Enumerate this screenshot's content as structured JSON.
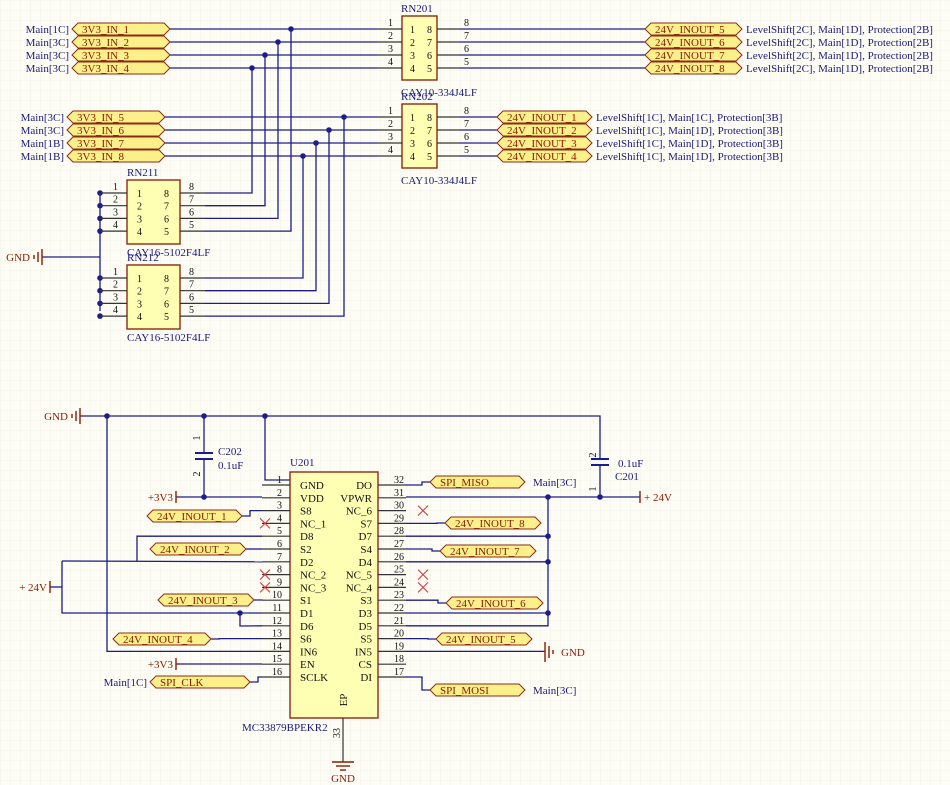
{
  "colors": {
    "wire": "#1c1c8c",
    "component_fill": "#ffffb4",
    "port_fill": "#fbf08a",
    "power": "#8b1a00",
    "background": "#fdfcf5"
  },
  "rn_top": [
    {
      "ref": "RN201",
      "value": "CAY10-334J4LF",
      "left_ports": [
        {
          "net": "3V3_IN_1",
          "sheet_ref": "Main[1C]"
        },
        {
          "net": "3V3_IN_2",
          "sheet_ref": "Main[3C]"
        },
        {
          "net": "3V3_IN_3",
          "sheet_ref": "Main[3C]"
        },
        {
          "net": "3V3_IN_4",
          "sheet_ref": "Main[3C]"
        }
      ],
      "right_ports": [
        {
          "net": "24V_INOUT_5",
          "sheet_ref": "LevelShift[2C], Main[1D], Protection[2B]"
        },
        {
          "net": "24V_INOUT_6",
          "sheet_ref": "LevelShift[2C], Main[1D], Protection[2B]"
        },
        {
          "net": "24V_INOUT_7",
          "sheet_ref": "LevelShift[2C], Main[1D], Protection[2B]"
        },
        {
          "net": "24V_INOUT_8",
          "sheet_ref": "LevelShift[2C], Main[1D], Protection[2B]"
        }
      ]
    },
    {
      "ref": "RN202",
      "value": "CAY10-334J4LF",
      "left_ports": [
        {
          "net": "3V3_IN_5",
          "sheet_ref": "Main[3C]"
        },
        {
          "net": "3V3_IN_6",
          "sheet_ref": "Main[3C]"
        },
        {
          "net": "3V3_IN_7",
          "sheet_ref": "Main[1B]"
        },
        {
          "net": "3V3_IN_8",
          "sheet_ref": "Main[1B]"
        }
      ],
      "right_ports": [
        {
          "net": "24V_INOUT_1",
          "sheet_ref": "LevelShift[1C], Main[1C], Protection[3B]"
        },
        {
          "net": "24V_INOUT_2",
          "sheet_ref": "LevelShift[1C], Main[1D], Protection[3B]"
        },
        {
          "net": "24V_INOUT_3",
          "sheet_ref": "LevelShift[1C], Main[1D], Protection[3B]"
        },
        {
          "net": "24V_INOUT_4",
          "sheet_ref": "LevelShift[1C], Main[1D], Protection[3B]"
        }
      ]
    }
  ],
  "rn_pins": {
    "left": [
      "1",
      "2",
      "3",
      "4"
    ],
    "right": [
      "8",
      "7",
      "6",
      "5"
    ]
  },
  "rn_pull": [
    {
      "ref": "RN211",
      "value": "CAY16-5102F4LF"
    },
    {
      "ref": "RN212",
      "value": "CAY16-5102F4LF"
    }
  ],
  "caps": [
    {
      "ref": "C202",
      "value": "0.1uF",
      "pins": [
        "1",
        "2"
      ]
    },
    {
      "ref": "C201",
      "value": "0.1uF",
      "pins": [
        "2",
        "1"
      ]
    }
  ],
  "u201": {
    "ref": "U201",
    "value": "MC33879BPEKR2",
    "ep_label": "EP",
    "ep_pin": "33",
    "left_pins": [
      [
        "1",
        "GND"
      ],
      [
        "2",
        "VDD"
      ],
      [
        "3",
        "S8"
      ],
      [
        "4",
        "NC_1"
      ],
      [
        "5",
        "D8"
      ],
      [
        "6",
        "S2"
      ],
      [
        "7",
        "D2"
      ],
      [
        "8",
        "NC_2"
      ],
      [
        "9",
        "NC_3"
      ],
      [
        "10",
        "S1"
      ],
      [
        "11",
        "D1"
      ],
      [
        "12",
        "D6"
      ],
      [
        "13",
        "S6"
      ],
      [
        "14",
        "IN6"
      ],
      [
        "15",
        "EN"
      ],
      [
        "16",
        "SCLK"
      ]
    ],
    "right_pins": [
      [
        "32",
        "DO"
      ],
      [
        "31",
        "VPWR"
      ],
      [
        "30",
        "NC_6"
      ],
      [
        "29",
        "S7"
      ],
      [
        "28",
        "D7"
      ],
      [
        "27",
        "S4"
      ],
      [
        "26",
        "D4"
      ],
      [
        "25",
        "NC_5"
      ],
      [
        "24",
        "NC_4"
      ],
      [
        "23",
        "S3"
      ],
      [
        "22",
        "D3"
      ],
      [
        "21",
        "D5"
      ],
      [
        "20",
        "S5"
      ],
      [
        "19",
        "IN5"
      ],
      [
        "18",
        "CS"
      ],
      [
        "17",
        "DI"
      ]
    ]
  },
  "ports_bottom": [
    {
      "net": "24V_INOUT_1"
    },
    {
      "net": "24V_INOUT_2"
    },
    {
      "net": "24V_INOUT_3"
    },
    {
      "net": "24V_INOUT_4"
    },
    {
      "net": "SPI_CLK",
      "sheet_ref": "Main[1C]"
    },
    {
      "net": "SPI_MISO",
      "sheet_ref": "Main[3C]"
    },
    {
      "net": "24V_INOUT_8"
    },
    {
      "net": "24V_INOUT_7"
    },
    {
      "net": "24V_INOUT_6"
    },
    {
      "net": "24V_INOUT_5"
    },
    {
      "net": "SPI_MOSI",
      "sheet_ref": "Main[3C]"
    }
  ],
  "power": {
    "gnd": "GND",
    "p3v3": "+3V3",
    "p24v": "+ 24V"
  }
}
